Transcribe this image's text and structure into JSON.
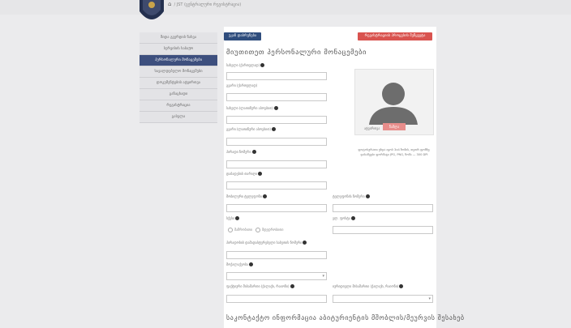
{
  "header": {
    "breadcrumb": "/ JST (ცენტრალური რეგისტრაცია)"
  },
  "sidebar": {
    "items": [
      {
        "label": "შიდა გვერდის ნახვა"
      },
      {
        "label": "სერვისის საბაჟო"
      },
      {
        "label": "პერსონალური მონაცემები",
        "active": true
      },
      {
        "label": "სავალდებულო მონაცემები"
      },
      {
        "label": "დოკუმენტების ატვირთვა"
      },
      {
        "label": "განაცხადი"
      },
      {
        "label": "რეგისტრაცია"
      },
      {
        "label": "გასვლა"
      }
    ]
  },
  "toolbar": {
    "back_label": "უკან დაბრუნება",
    "red_label": "რეგისტრაციის პროცესის შეწყვეტა"
  },
  "form": {
    "title": "მიუთითეთ პერსონალური მონაცემები",
    "fields": {
      "firstname_ka": "სახელი (ქართულად)",
      "lastname_ka": "გვარი (ქართულად)",
      "firstname_lat": "სახელი (ლათინური ასოებით)",
      "lastname_lat": "გვარი (ლათინური ასოებით)",
      "personal_id": "პირადი ნომერი",
      "birth_date": "დაბადების თარიღი",
      "phone_mobile": "მობილური ტელეფონი",
      "phone_home": "ტელეფონის ნომერი",
      "email": "ელ. ფოსტა",
      "gender": "სქესი",
      "citizenship": "მოქალაქეობა",
      "doc_number": "პირადობის დამადასტურებელი საბუთის ნომერი",
      "doc_type": "საბუთის ტიპი",
      "address_actual": "ფაქტიური მისამართი (ქალაქი, რაიონი)",
      "address_legal": "იურიდიული მისამართი (ქალაქი, რაიონი)"
    },
    "gender_options": [
      "მამრობითი",
      "მდედრობითი"
    ],
    "photo": {
      "choose_label": "ატვირთვა",
      "delete_label": "წაშლა",
      "note": "ფოტოსურათი უნდა იყოს 3x4 ზომის, თეთრ ფონზე; დასაშვები ფორმატი JPG, PNG, ზომა — 300 DPI"
    },
    "section2_title": "საკონტაქტო ინფორმაცია აბიტურიენტის მშობლის/მეურვის შესახებ"
  }
}
